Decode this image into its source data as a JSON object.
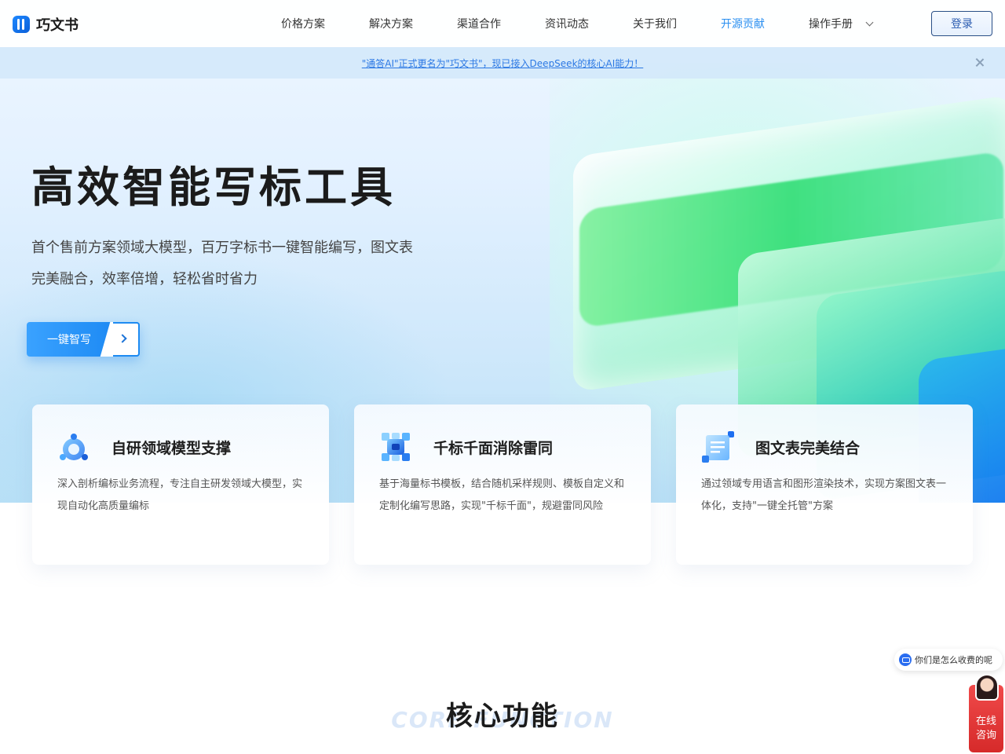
{
  "nav": {
    "logo_text": "巧文书",
    "items": [
      {
        "label": "价格方案"
      },
      {
        "label": "解决方案"
      },
      {
        "label": "渠道合作"
      },
      {
        "label": "资讯动态"
      },
      {
        "label": "关于我们"
      },
      {
        "label": "开源贡献",
        "active": true
      }
    ],
    "manual_label": "操作手册",
    "login_label": "登录",
    "active_color": "#2b8ff0"
  },
  "notice": {
    "text": "\"通答AI\"正式更名为\"巧文书\"，现已接入DeepSeek的核心AI能力！"
  },
  "hero": {
    "title": "高效智能写标工具",
    "desc_line1": "首个售前方案领域大模型，百万字标书一键智能编写，图文表",
    "desc_line2": "完美融合，效率倍增，轻松省时省力",
    "cta_label": "一键智写"
  },
  "features": [
    {
      "icon": "model-support-icon",
      "title": "自研领域模型支撑",
      "desc": "深入剖析编标业务流程，专注自主研发领域大模型，实现自动化高质量编标"
    },
    {
      "icon": "dedupe-icon",
      "title": "千标千面消除雷同",
      "desc": "基于海量标书模板，结合随机采样规则、模板自定义和定制化编写思路，实现\"千标千面\"，规避雷同风险"
    },
    {
      "icon": "document-table-icon",
      "title": "图文表完美结合",
      "desc": "通过领域专用语言和图形渲染技术，实现方案图文表一体化，支持\"一键全托管\"方案"
    }
  ],
  "section": {
    "title": "核心功能",
    "subtitle": "CORE FUNCTION"
  },
  "chat": {
    "bubble_text": "你们是怎么收费的呢",
    "consult_line1": "在线",
    "consult_line2": "咨询"
  }
}
